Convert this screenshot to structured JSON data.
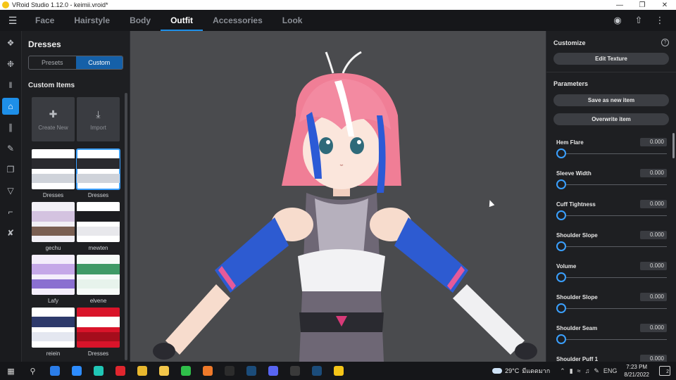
{
  "window": {
    "title": "VRoid Studio 1.12.0 - keimii.vroid*"
  },
  "appbar": {
    "tabs": [
      "Face",
      "Hairstyle",
      "Body",
      "Outfit",
      "Accessories",
      "Look"
    ],
    "active_tab": "Outfit"
  },
  "rail": {
    "items": [
      "shirt-icon",
      "jacket-icon",
      "pants-icon",
      "dress-icon",
      "socks-icon",
      "brush-icon",
      "bag-icon",
      "swimsuit-icon",
      "boot-icon",
      "ribbon-icon"
    ],
    "active_index": 3
  },
  "left_panel": {
    "title": "Dresses",
    "segments": [
      "Presets",
      "Custom"
    ],
    "active_segment": "Custom",
    "subtitle": "Custom Items",
    "create_new": "Create New",
    "import": "Import",
    "items": [
      {
        "label": "Dresses",
        "colors": [
          "#ffffff",
          "#2a2a2e",
          "#cfd3da"
        ],
        "selected": false
      },
      {
        "label": "Dresses",
        "colors": [
          "#ffffff",
          "#2a2a2e",
          "#cfd3da"
        ],
        "selected": true
      },
      {
        "label": "gechu",
        "colors": [
          "#f2f0f6",
          "#d4c3e0",
          "#7a5f52"
        ],
        "selected": false
      },
      {
        "label": "mewten",
        "colors": [
          "#ffffff",
          "#1c1c20",
          "#e8e8ec"
        ],
        "selected": false
      },
      {
        "label": "Lafy",
        "colors": [
          "#f4eefb",
          "#c5a8e8",
          "#8a6fd0"
        ],
        "selected": false
      },
      {
        "label": "elvene",
        "colors": [
          "#f6fbf8",
          "#3f9a66",
          "#e7f3ec"
        ],
        "selected": false
      },
      {
        "label": "reiein",
        "colors": [
          "#ffffff",
          "#2e3a6b",
          "#e4e7f0"
        ],
        "selected": false
      },
      {
        "label": "Dresses",
        "colors": [
          "#d9142a",
          "#ffffff",
          "#a50d1c"
        ],
        "selected": false
      }
    ]
  },
  "right_panel": {
    "customize_title": "Customize",
    "edit_texture": "Edit Texture",
    "parameters_title": "Parameters",
    "save_new": "Save as new item",
    "overwrite": "Overwrite item",
    "params": [
      {
        "name": "Hem Flare",
        "value": "0.000",
        "level": 0
      },
      {
        "name": "Sleeve Width",
        "value": "0.000",
        "level": 0
      },
      {
        "name": "Cuff Tightness",
        "value": "0.000",
        "level": 0
      },
      {
        "name": "Shoulder Slope",
        "value": "0.000",
        "level": 0
      },
      {
        "name": "Volume",
        "value": "0.000",
        "level": 0
      },
      {
        "name": "Shoulder Slope",
        "value": "0.000",
        "level": 0
      },
      {
        "name": "Shoulder Seam",
        "value": "0.000",
        "level": 0
      },
      {
        "name": "Shoulder Puff 1",
        "value": "0.000",
        "level": 0
      }
    ]
  },
  "taskbar": {
    "apps": [
      {
        "name": "mail-app",
        "color": "#2b7de9"
      },
      {
        "name": "zoom-app",
        "color": "#2d8cff"
      },
      {
        "name": "game-app",
        "color": "#20c6b6"
      },
      {
        "name": "red-app",
        "color": "#e0262e"
      },
      {
        "name": "chrome-app",
        "color": "#e9b82e"
      },
      {
        "name": "explorer-app",
        "color": "#f3c74a"
      },
      {
        "name": "line-app",
        "color": "#2fc04a"
      },
      {
        "name": "orange-app",
        "color": "#f07a2a"
      },
      {
        "name": "epic-app",
        "color": "#2c2c2c"
      },
      {
        "name": "steam-app",
        "color": "#1b4c7a"
      },
      {
        "name": "discord-app",
        "color": "#5865f2"
      },
      {
        "name": "obs-app",
        "color": "#3a3a3a"
      },
      {
        "name": "steam-app-2",
        "color": "#1b4c7a"
      },
      {
        "name": "vroid-app",
        "color": "#f5c518"
      }
    ],
    "temperature": "29°C",
    "weather_text": "มีแดดมาก",
    "language": "ENG",
    "time": "7:23 PM",
    "date": "8/21/2022",
    "notifications": "2"
  }
}
